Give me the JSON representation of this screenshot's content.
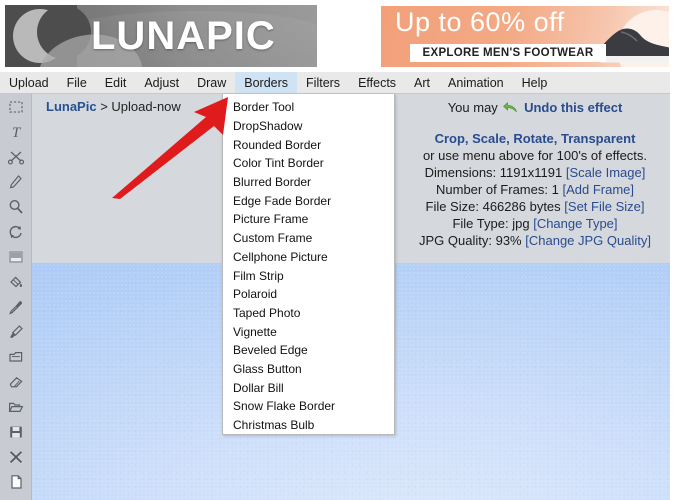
{
  "brand": {
    "logo_text": "LUNAPIC",
    "logo_icon": "crescent-moon-icon"
  },
  "ad": {
    "headline": "Up to 60% off",
    "cta_label": "EXPLORE MEN'S FOOTWEAR",
    "product_icon": "sneaker-icon"
  },
  "menubar": {
    "items": [
      {
        "label": "Upload",
        "active": false
      },
      {
        "label": "File",
        "active": false
      },
      {
        "label": "Edit",
        "active": false
      },
      {
        "label": "Adjust",
        "active": false
      },
      {
        "label": "Draw",
        "active": false
      },
      {
        "label": "Borders",
        "active": true
      },
      {
        "label": "Filters",
        "active": false
      },
      {
        "label": "Effects",
        "active": false
      },
      {
        "label": "Art",
        "active": false
      },
      {
        "label": "Animation",
        "active": false
      },
      {
        "label": "Help",
        "active": false
      }
    ],
    "highlight_color": "#cfe3f5"
  },
  "dropdown": {
    "owner": "Borders",
    "items": [
      {
        "label": "Border Tool"
      },
      {
        "label": "DropShadow"
      },
      {
        "label": "Rounded Border"
      },
      {
        "label": "Color Tint Border"
      },
      {
        "label": "Blurred Border"
      },
      {
        "label": "Edge Fade Border"
      },
      {
        "label": "Picture Frame"
      },
      {
        "label": "Custom Frame"
      },
      {
        "label": "Cellphone Picture"
      },
      {
        "label": "Film Strip"
      },
      {
        "label": "Polaroid"
      },
      {
        "label": "Taped Photo"
      },
      {
        "label": "Vignette"
      },
      {
        "label": "Beveled Edge"
      },
      {
        "label": "Glass Button"
      },
      {
        "label": "Dollar Bill"
      },
      {
        "label": "Snow Flake Border"
      },
      {
        "label": "Christmas Bulb"
      }
    ]
  },
  "toolbar": {
    "tools": [
      {
        "name": "marquee-select-icon"
      },
      {
        "name": "text-tool-icon"
      },
      {
        "name": "scissors-icon"
      },
      {
        "name": "pencil-icon"
      },
      {
        "name": "magnifier-icon"
      },
      {
        "name": "rotate-icon"
      },
      {
        "name": "gradient-icon"
      },
      {
        "name": "paint-bucket-icon"
      },
      {
        "name": "eyedropper-icon"
      },
      {
        "name": "paintbrush-icon"
      },
      {
        "name": "clone-stamp-icon"
      },
      {
        "name": "eraser-icon"
      },
      {
        "name": "open-folder-icon"
      },
      {
        "name": "save-floppy-icon"
      },
      {
        "name": "close-x-icon"
      },
      {
        "name": "new-file-icon"
      }
    ]
  },
  "breadcrumb": {
    "root": "LunaPic",
    "separator": ">",
    "current": "Upload-now"
  },
  "info": {
    "undo_prefix": "You may",
    "undo_icon": "undo-arrow-icon",
    "undo_link": "Undo this effect",
    "quick_links": "Crop, Scale, Rotate, Transparent",
    "menu_hint": "or use menu above for 100's of effects.",
    "dimensions_label": "Dimensions:",
    "dimensions_value": "1191x1191",
    "dimensions_link": "[Scale Image]",
    "frames_label": "Number of Frames:",
    "frames_value": "1",
    "frames_link": "[Add Frame]",
    "filesize_label": "File Size:",
    "filesize_value": "466286 bytes",
    "filesize_link": "[Set File Size]",
    "filetype_label": "File Type:",
    "filetype_value": "jpg",
    "filetype_link": "[Change Type]",
    "quality_label": "JPG Quality:",
    "quality_value": "93%",
    "quality_link": "[Change JPG Quality]",
    "link_color": "#2a4b8d"
  },
  "annotation": {
    "arrow_name": "red-pointer-arrow",
    "arrow_color": "#e01b1b",
    "points_at": "Border Tool"
  },
  "canvas": {
    "image_description": "sky-blue-image",
    "base_color": "#a8c8f5"
  }
}
